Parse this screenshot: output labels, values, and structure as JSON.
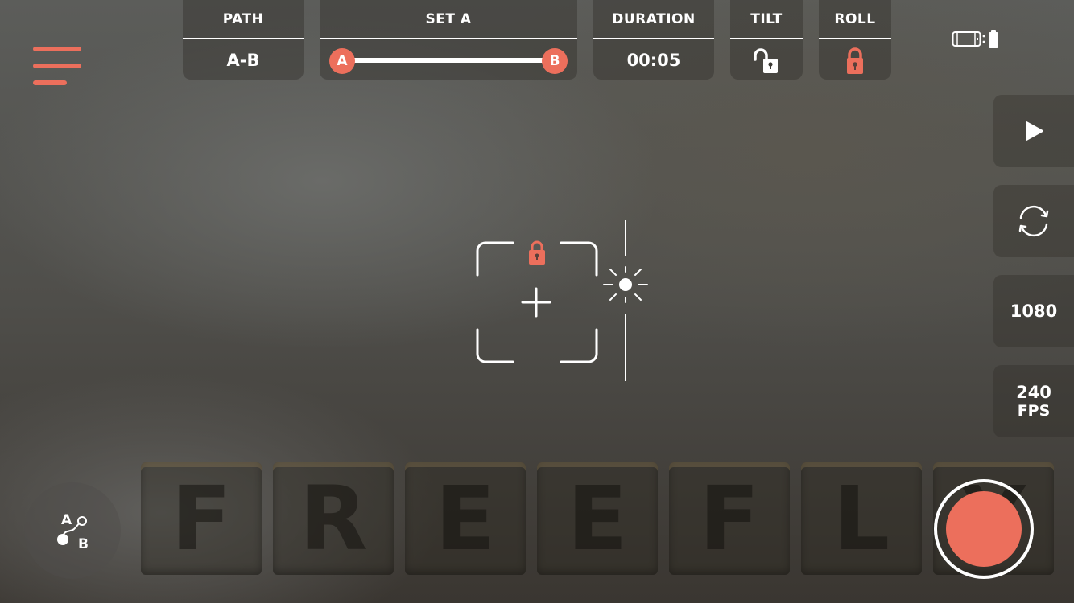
{
  "background": {
    "brand_letters": [
      "F",
      "R",
      "E",
      "E",
      "F",
      "L",
      "Y"
    ]
  },
  "colors": {
    "accent": "#ec6f5c",
    "text": "#ffffff"
  },
  "menu": {
    "icon": "hamburger-menu-icon"
  },
  "top_bar": {
    "path": {
      "title": "PATH",
      "value": "A-B"
    },
    "set": {
      "title": "SET A",
      "start_label": "A",
      "end_label": "B"
    },
    "duration": {
      "title": "DURATION",
      "value": "00:05"
    },
    "tilt": {
      "title": "TILT",
      "state": "unlocked",
      "icon": "unlock-icon"
    },
    "roll": {
      "title": "ROLL",
      "state": "locked",
      "icon": "lock-icon"
    }
  },
  "status": {
    "icon": "phone-gimbal-battery-icon"
  },
  "side_buttons": {
    "play": {
      "icon": "play-icon"
    },
    "swap": {
      "icon": "refresh-icon"
    },
    "resolution": {
      "value": "1080"
    },
    "fps": {
      "value": "240",
      "unit": "FPS"
    }
  },
  "viewfinder": {
    "focus_lock": "locked",
    "exposure_icon": "sun-icon"
  },
  "path_mode_button": {
    "start_label": "A",
    "end_label": "B"
  },
  "record_button": {
    "state": "idle"
  }
}
